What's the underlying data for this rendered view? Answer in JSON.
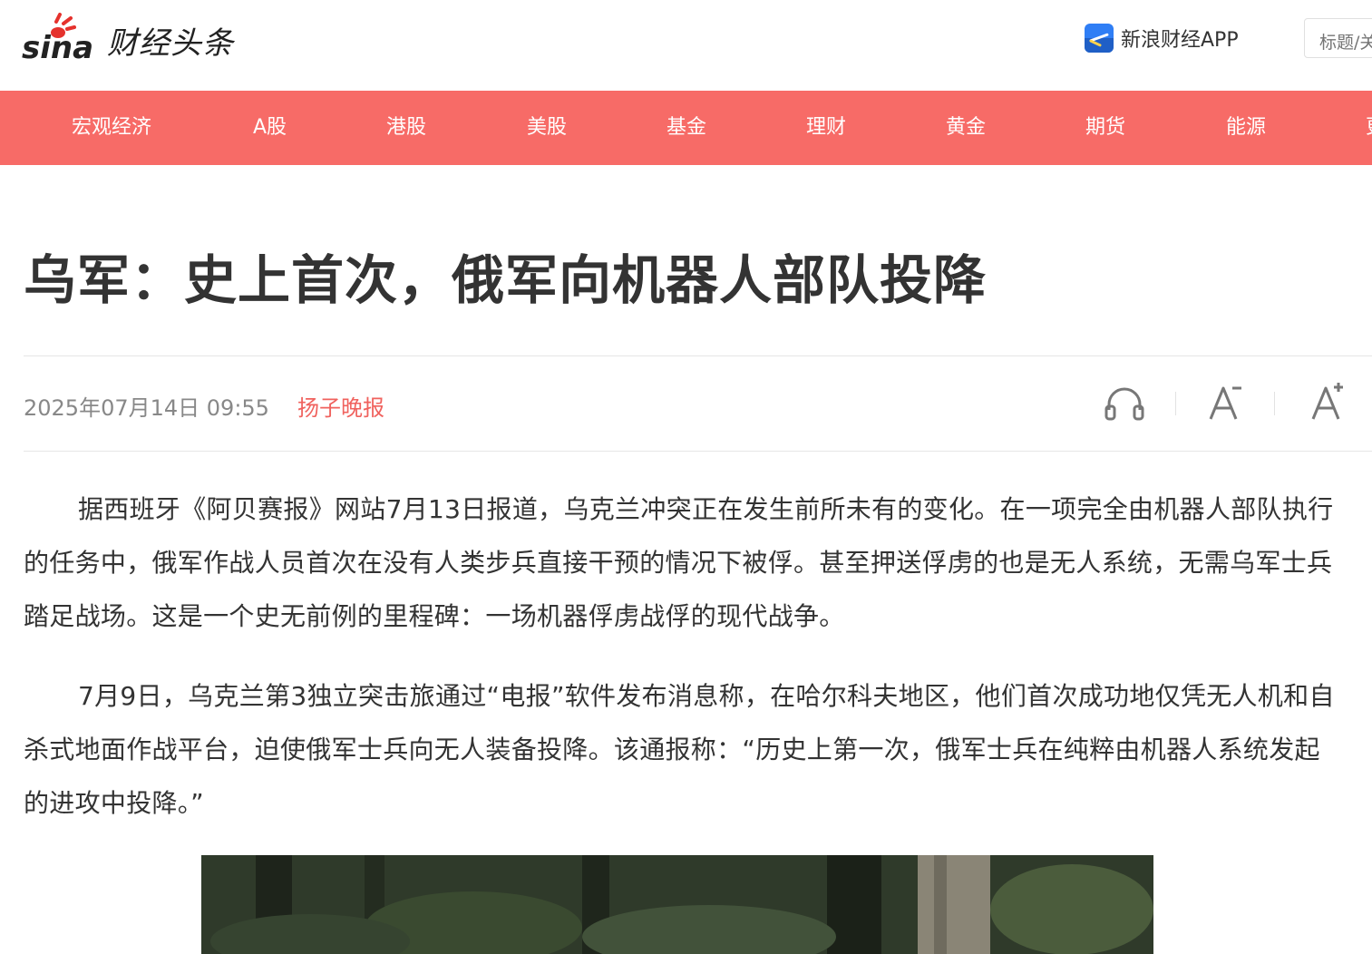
{
  "header": {
    "logo_text": "财经头条",
    "app_label": "新浪财经APP",
    "search_placeholder": "标题/关键字"
  },
  "nav": {
    "items": [
      "宏观经济",
      "A股",
      "港股",
      "美股",
      "基金",
      "理财",
      "黄金",
      "期货",
      "能源",
      "更多"
    ]
  },
  "article": {
    "title": "乌军：史上首次，俄军向机器人部队投降",
    "date": "2025年07月14日 09:55",
    "source": "扬子晚报",
    "paragraphs": [
      "据西班牙《阿贝赛报》网站7月13日报道，乌克兰冲突正在发生前所未有的变化。在一项完全由机器人部队执行的任务中，俄军作战人员首次在没有人类步兵直接干预的情况下被俘。甚至押送俘虏的也是无人系统，无需乌军士兵踏足战场。这是一个史无前例的里程碑：一场机器俘虏战俘的现代战争。",
      "7月9日，乌克兰第3独立突击旅通过“电报”软件发布消息称，在哈尔科夫地区，他们首次成功地仅凭无人机和自杀式地面作战平台，迫使俄军士兵向无人装备投降。该通报称：“历史上第一次，俄军士兵在纯粹由机器人系统发起的进攻中投降。”"
    ]
  },
  "colors": {
    "nav_bg": "#f76b67",
    "source_red": "#f0625e",
    "text_main": "#333333",
    "text_meta": "#888888"
  },
  "icons": {
    "listen": "headphones-icon",
    "font_smaller": "font-decrease-icon",
    "font_larger": "font-increase-icon"
  }
}
